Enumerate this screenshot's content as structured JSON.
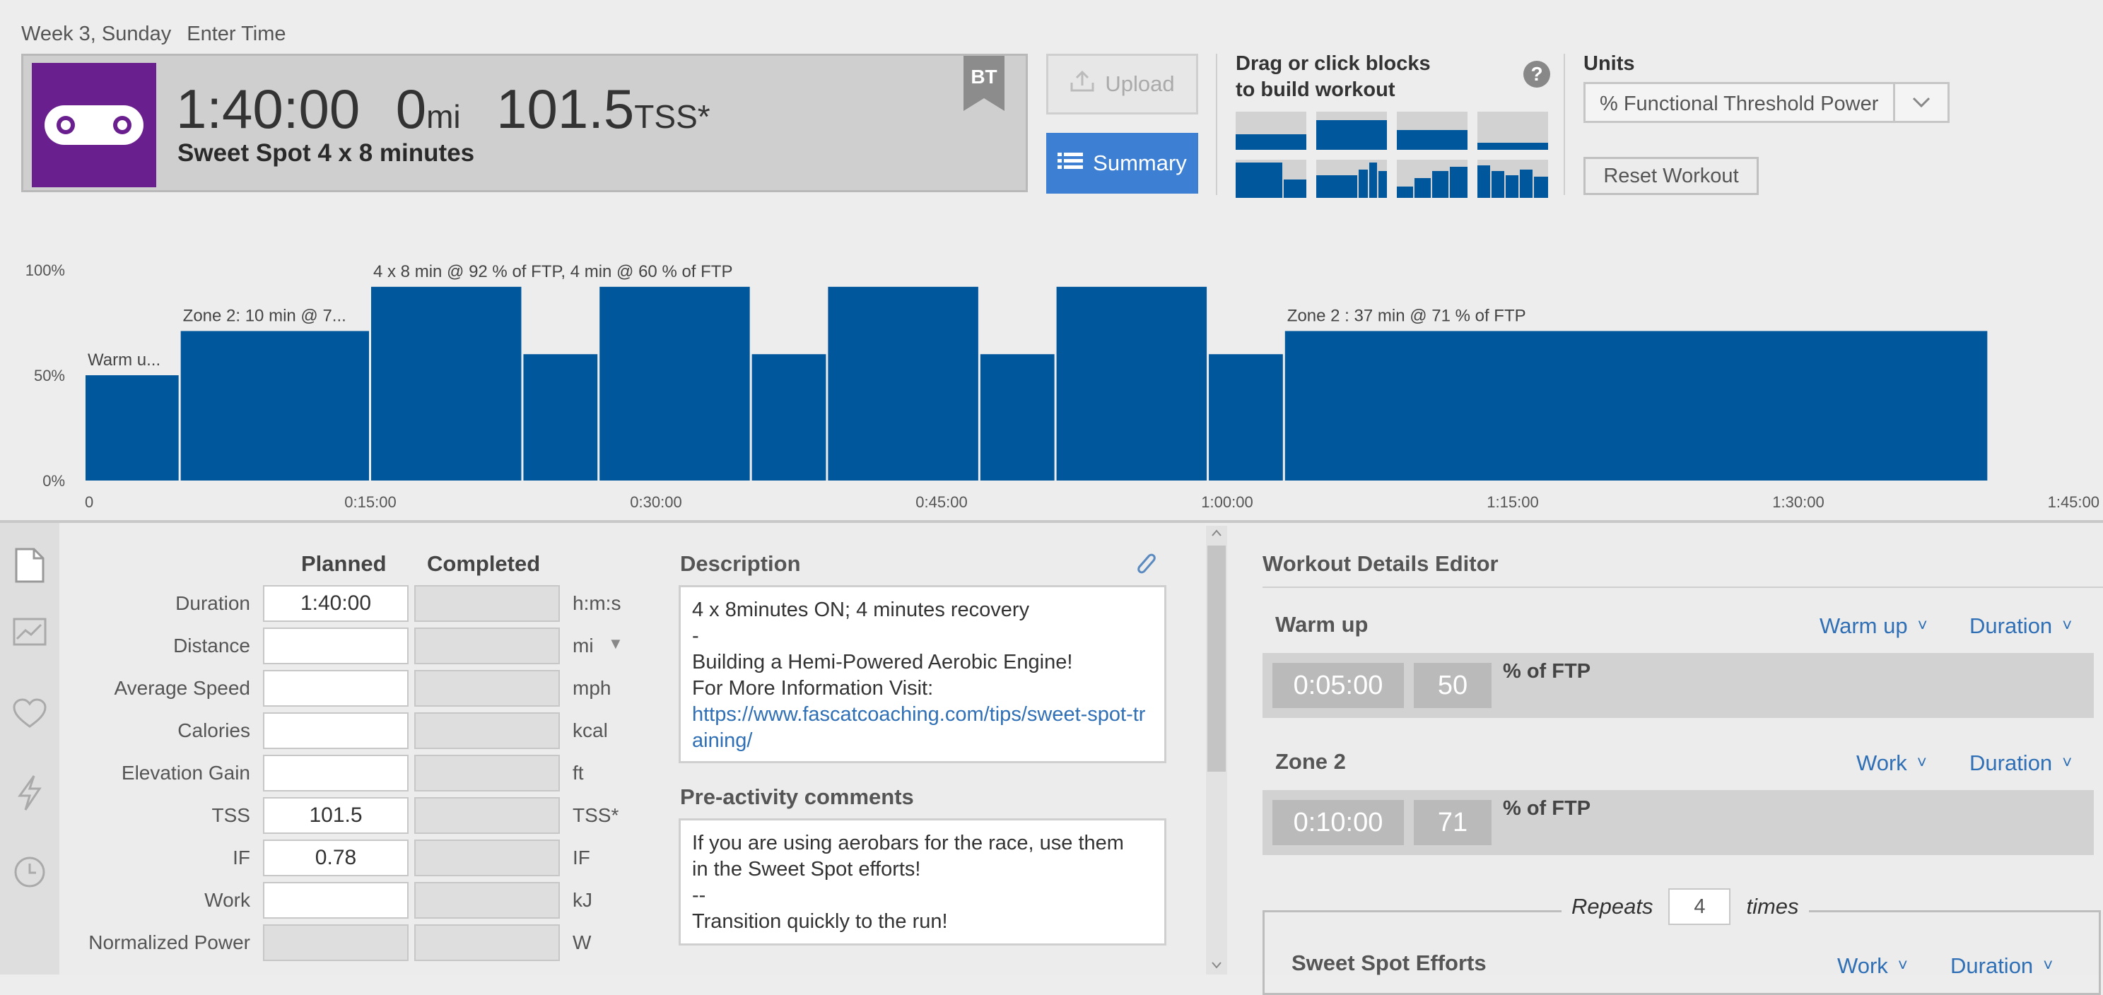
{
  "header": {
    "week_day": "Week 3, Sunday",
    "enter_time": "Enter Time"
  },
  "workout": {
    "duration": "1:40:00",
    "distance_value": "0",
    "distance_unit": "mi",
    "tss_value": "101.5",
    "tss_unit": "TSS*",
    "title": "Sweet Spot 4 x 8 minutes",
    "flag": "BT"
  },
  "buttons": {
    "upload": "Upload",
    "summary": "Summary",
    "reset": "Reset Workout"
  },
  "builder": {
    "title_line1": "Drag or click blocks",
    "title_line2": "to build workout",
    "help": "?"
  },
  "units": {
    "label": "Units",
    "selected": "% Functional Threshold Power"
  },
  "colors": {
    "bar": "#00579c",
    "accent_blue": "#3c7fd3",
    "sport_purple": "#6a1f8f"
  },
  "chart_data": {
    "type": "bar",
    "x_unit": "seconds",
    "xlim": [
      0,
      6300
    ],
    "ylim": [
      0,
      100
    ],
    "y_ticks": [
      "100%",
      "50%",
      "0%"
    ],
    "x_ticks": [
      {
        "t": 0,
        "label": "0"
      },
      {
        "t": 900,
        "label": "0:15:00"
      },
      {
        "t": 1800,
        "label": "0:30:00"
      },
      {
        "t": 2700,
        "label": "0:45:00"
      },
      {
        "t": 3600,
        "label": "1:00:00"
      },
      {
        "t": 4500,
        "label": "1:15:00"
      },
      {
        "t": 5400,
        "label": "1:30:00"
      },
      {
        "t": 6300,
        "label": "1:45:00"
      }
    ],
    "segments": [
      {
        "start": 0,
        "end": 300,
        "value": 50
      },
      {
        "start": 300,
        "end": 900,
        "value": 71
      },
      {
        "start": 900,
        "end": 1380,
        "value": 92
      },
      {
        "start": 1380,
        "end": 1620,
        "value": 60
      },
      {
        "start": 1620,
        "end": 2100,
        "value": 92
      },
      {
        "start": 2100,
        "end": 2340,
        "value": 60
      },
      {
        "start": 2340,
        "end": 2820,
        "value": 92
      },
      {
        "start": 2820,
        "end": 3060,
        "value": 60
      },
      {
        "start": 3060,
        "end": 3540,
        "value": 92
      },
      {
        "start": 3540,
        "end": 3780,
        "value": 60
      },
      {
        "start": 3780,
        "end": 6000,
        "value": 71
      }
    ],
    "annotations": [
      {
        "t": 0,
        "value": 50,
        "text": "Warm u..."
      },
      {
        "t": 300,
        "value": 71,
        "text": "Zone 2: 10 min @ 7..."
      },
      {
        "t": 900,
        "value": 92,
        "text": "4 x 8 min @ 92 % of FTP, 4 min @ 60 % of FTP"
      },
      {
        "t": 3780,
        "value": 71,
        "text": "Zone 2 : 37 min @ 71 % of FTP"
      }
    ]
  },
  "table": {
    "planned_header": "Planned",
    "completed_header": "Completed",
    "rows": [
      {
        "label": "Duration",
        "planned": "1:40:00",
        "completed": "",
        "unit": "h:m:s"
      },
      {
        "label": "Distance",
        "planned": "",
        "completed": "",
        "unit": "mi"
      },
      {
        "label": "Average Speed",
        "planned": "",
        "completed": "",
        "unit": "mph"
      },
      {
        "label": "Calories",
        "planned": "",
        "completed": "",
        "unit": "kcal"
      },
      {
        "label": "Elevation Gain",
        "planned": "",
        "completed": "",
        "unit": "ft"
      },
      {
        "label": "TSS",
        "planned": "101.5",
        "completed": "",
        "unit": "TSS*"
      },
      {
        "label": "IF",
        "planned": "0.78",
        "completed": "",
        "unit": "IF"
      },
      {
        "label": "Work",
        "planned": "",
        "completed": "",
        "unit": "kJ"
      },
      {
        "label": "Normalized Power",
        "planned": "",
        "completed": "",
        "unit": "W"
      }
    ]
  },
  "description": {
    "title": "Description",
    "line1": "4 x 8minutes ON; 4 minutes recovery",
    "line2": "-",
    "line3": "Building a Hemi-Powered Aerobic Engine!",
    "line4": "For More Information Visit:",
    "link": "https://www.fascatcoaching.com/tips/sweet-spot-training/"
  },
  "pre_activity": {
    "title": "Pre-activity comments",
    "line1": "If you are using aerobars for the race, use them",
    "line2": "in the Sweet Spot efforts!",
    "line3": "--",
    "line4": "Transition quickly to the run!"
  },
  "editor": {
    "title": "Workout Details Editor",
    "steps": [
      {
        "name": "Warm up",
        "type": "Warm up",
        "mode": "Duration",
        "time": "0:05:00",
        "pct": "50",
        "unit": "% of FTP"
      },
      {
        "name": "Zone 2",
        "type": "Work",
        "mode": "Duration",
        "time": "0:10:00",
        "pct": "71",
        "unit": "% of FTP"
      }
    ],
    "repeat": {
      "label": "Repeats",
      "count": "4",
      "times": "times",
      "step_name": "Sweet Spot Efforts",
      "type": "Work",
      "mode": "Duration"
    }
  }
}
